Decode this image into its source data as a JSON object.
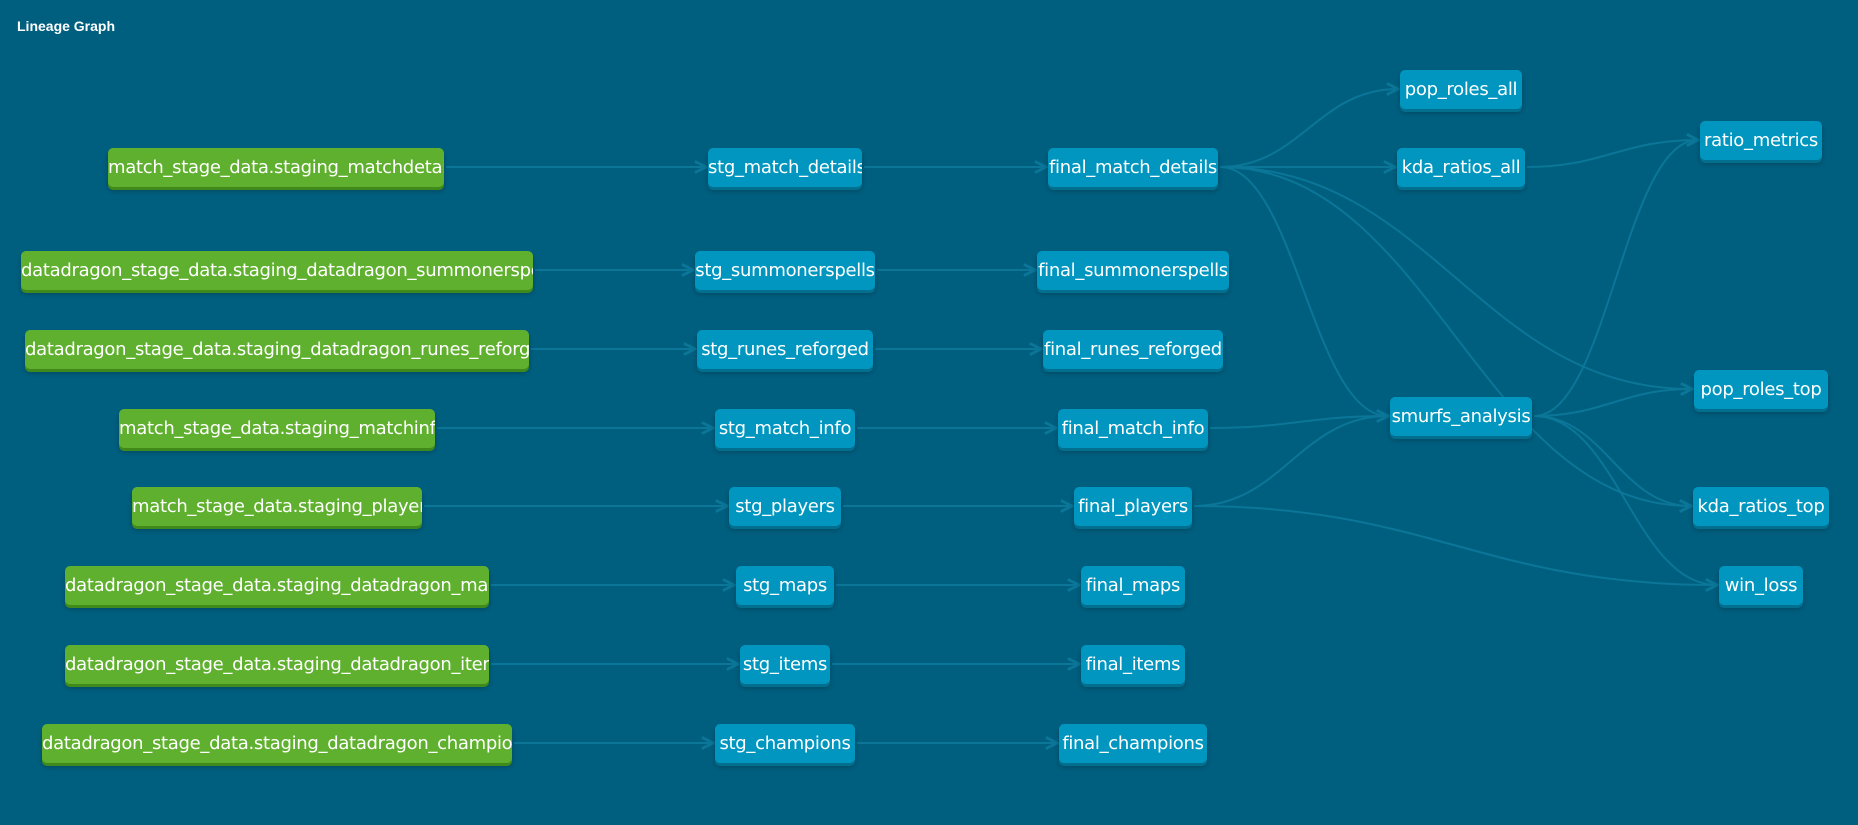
{
  "header": {
    "title": "Lineage Graph"
  },
  "colors": {
    "background": "#005f7f",
    "source_node": "#5fb02e",
    "model_node": "#0196bf",
    "edge": "#0b7698"
  },
  "nodes": [
    {
      "id": "src_matchdetails",
      "label": "match_stage_data.staging_matchdetails",
      "kind": "source"
    },
    {
      "id": "src_summonerspells",
      "label": "datadragon_stage_data.staging_datadragon_summonerspells",
      "kind": "source"
    },
    {
      "id": "src_runes",
      "label": "datadragon_stage_data.staging_datadragon_runes_reforged",
      "kind": "source"
    },
    {
      "id": "src_matchinfo",
      "label": "match_stage_data.staging_matchinfo",
      "kind": "source"
    },
    {
      "id": "src_players",
      "label": "match_stage_data.staging_players",
      "kind": "source"
    },
    {
      "id": "src_maps",
      "label": "datadragon_stage_data.staging_datadragon_maps",
      "kind": "source"
    },
    {
      "id": "src_items",
      "label": "datadragon_stage_data.staging_datadragon_items",
      "kind": "source"
    },
    {
      "id": "src_champions",
      "label": "datadragon_stage_data.staging_datadragon_champions",
      "kind": "source"
    },
    {
      "id": "stg_match_details",
      "label": "stg_match_details",
      "kind": "model"
    },
    {
      "id": "stg_summonerspells",
      "label": "stg_summonerspells",
      "kind": "model"
    },
    {
      "id": "stg_runes_reforged",
      "label": "stg_runes_reforged",
      "kind": "model"
    },
    {
      "id": "stg_match_info",
      "label": "stg_match_info",
      "kind": "model"
    },
    {
      "id": "stg_players",
      "label": "stg_players",
      "kind": "model"
    },
    {
      "id": "stg_maps",
      "label": "stg_maps",
      "kind": "model"
    },
    {
      "id": "stg_items",
      "label": "stg_items",
      "kind": "model"
    },
    {
      "id": "stg_champions",
      "label": "stg_champions",
      "kind": "model"
    },
    {
      "id": "final_match_details",
      "label": "final_match_details",
      "kind": "model"
    },
    {
      "id": "final_summonerspells",
      "label": "final_summonerspells",
      "kind": "model"
    },
    {
      "id": "final_runes_reforged",
      "label": "final_runes_reforged",
      "kind": "model"
    },
    {
      "id": "final_match_info",
      "label": "final_match_info",
      "kind": "model"
    },
    {
      "id": "final_players",
      "label": "final_players",
      "kind": "model"
    },
    {
      "id": "final_maps",
      "label": "final_maps",
      "kind": "model"
    },
    {
      "id": "final_items",
      "label": "final_items",
      "kind": "model"
    },
    {
      "id": "final_champions",
      "label": "final_champions",
      "kind": "model"
    },
    {
      "id": "pop_roles_all",
      "label": "pop_roles_all",
      "kind": "model"
    },
    {
      "id": "kda_ratios_all",
      "label": "kda_ratios_all",
      "kind": "model"
    },
    {
      "id": "smurfs_analysis",
      "label": "smurfs_analysis",
      "kind": "model"
    },
    {
      "id": "ratio_metrics",
      "label": "ratio_metrics",
      "kind": "model"
    },
    {
      "id": "pop_roles_top",
      "label": "pop_roles_top",
      "kind": "model"
    },
    {
      "id": "kda_ratios_top",
      "label": "kda_ratios_top",
      "kind": "model"
    },
    {
      "id": "win_loss",
      "label": "win_loss",
      "kind": "model"
    }
  ],
  "edges": [
    [
      "src_matchdetails",
      "stg_match_details"
    ],
    [
      "src_summonerspells",
      "stg_summonerspells"
    ],
    [
      "src_runes",
      "stg_runes_reforged"
    ],
    [
      "src_matchinfo",
      "stg_match_info"
    ],
    [
      "src_players",
      "stg_players"
    ],
    [
      "src_maps",
      "stg_maps"
    ],
    [
      "src_items",
      "stg_items"
    ],
    [
      "src_champions",
      "stg_champions"
    ],
    [
      "stg_match_details",
      "final_match_details"
    ],
    [
      "stg_summonerspells",
      "final_summonerspells"
    ],
    [
      "stg_runes_reforged",
      "final_runes_reforged"
    ],
    [
      "stg_match_info",
      "final_match_info"
    ],
    [
      "stg_players",
      "final_players"
    ],
    [
      "stg_maps",
      "final_maps"
    ],
    [
      "stg_items",
      "final_items"
    ],
    [
      "stg_champions",
      "final_champions"
    ],
    [
      "final_match_details",
      "pop_roles_all"
    ],
    [
      "final_match_details",
      "kda_ratios_all"
    ],
    [
      "final_match_details",
      "smurfs_analysis"
    ],
    [
      "final_match_details",
      "pop_roles_top"
    ],
    [
      "final_match_details",
      "kda_ratios_top"
    ],
    [
      "final_match_info",
      "smurfs_analysis"
    ],
    [
      "final_players",
      "smurfs_analysis"
    ],
    [
      "final_players",
      "win_loss"
    ],
    [
      "kda_ratios_all",
      "ratio_metrics"
    ],
    [
      "smurfs_analysis",
      "ratio_metrics"
    ],
    [
      "smurfs_analysis",
      "pop_roles_top"
    ],
    [
      "smurfs_analysis",
      "kda_ratios_top"
    ],
    [
      "smurfs_analysis",
      "win_loss"
    ]
  ]
}
